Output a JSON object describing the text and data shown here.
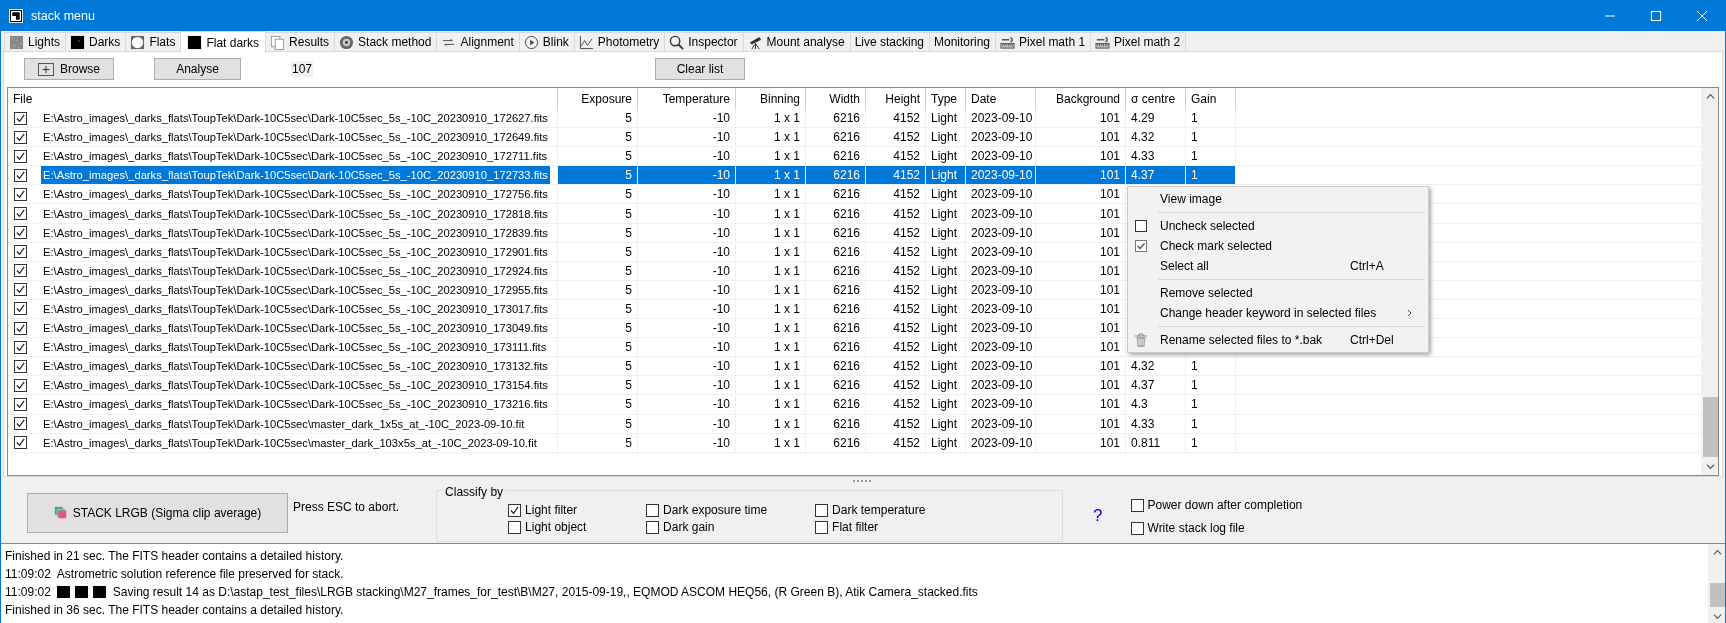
{
  "window": {
    "title": "stack menu"
  },
  "tabs": [
    {
      "label": "Lights",
      "selected": false
    },
    {
      "label": "Darks",
      "selected": false
    },
    {
      "label": "Flats",
      "selected": false
    },
    {
      "label": "Flat darks",
      "selected": true
    },
    {
      "label": "Results",
      "selected": false
    },
    {
      "label": "Stack method",
      "selected": false
    },
    {
      "label": "Alignment",
      "selected": false
    },
    {
      "label": "Blink",
      "selected": false
    },
    {
      "label": "Photometry",
      "selected": false
    },
    {
      "label": "Inspector",
      "selected": false
    },
    {
      "label": "Mount analyse",
      "selected": false
    },
    {
      "label": "Live stacking",
      "selected": false
    },
    {
      "label": "Monitoring",
      "selected": false
    },
    {
      "label": "Pixel math 1",
      "selected": false
    },
    {
      "label": "Pixel math 2",
      "selected": false
    }
  ],
  "toolbar": {
    "browse": "Browse",
    "analyse": "Analyse",
    "count": "107",
    "clear": "Clear list"
  },
  "table": {
    "columns": [
      {
        "label": "File"
      },
      {
        "label": "Exposure"
      },
      {
        "label": "Temperature"
      },
      {
        "label": "Binning"
      },
      {
        "label": "Width"
      },
      {
        "label": "Height"
      },
      {
        "label": "Type"
      },
      {
        "label": "Date"
      },
      {
        "label": "Background"
      },
      {
        "label": "σ centre"
      },
      {
        "label": "Gain"
      }
    ],
    "rows": [
      {
        "checked": true,
        "selected": false,
        "cells": [
          "E:\\Astro_images\\_darks_flats\\ToupTek\\Dark-10C5sec\\Dark-10C5sec_5s_-10C_20230910_172627.fits",
          "5",
          "-10",
          "1 x 1",
          "6216",
          "4152",
          "Light",
          "2023-09-10",
          "101",
          "4.29",
          "1"
        ]
      },
      {
        "checked": true,
        "selected": false,
        "cells": [
          "E:\\Astro_images\\_darks_flats\\ToupTek\\Dark-10C5sec\\Dark-10C5sec_5s_-10C_20230910_172649.fits",
          "5",
          "-10",
          "1 x 1",
          "6216",
          "4152",
          "Light",
          "2023-09-10",
          "101",
          "4.32",
          "1"
        ]
      },
      {
        "checked": true,
        "selected": false,
        "cells": [
          "E:\\Astro_images\\_darks_flats\\ToupTek\\Dark-10C5sec\\Dark-10C5sec_5s_-10C_20230910_172711.fits",
          "5",
          "-10",
          "1 x 1",
          "6216",
          "4152",
          "Light",
          "2023-09-10",
          "101",
          "4.33",
          "1"
        ]
      },
      {
        "checked": true,
        "selected": true,
        "cells": [
          "E:\\Astro_images\\_darks_flats\\ToupTek\\Dark-10C5sec\\Dark-10C5sec_5s_-10C_20230910_172733.fits",
          "5",
          "-10",
          "1 x 1",
          "6216",
          "4152",
          "Light",
          "2023-09-10",
          "101",
          "4.37",
          "1"
        ]
      },
      {
        "checked": true,
        "selected": false,
        "cells": [
          "E:\\Astro_images\\_darks_flats\\ToupTek\\Dark-10C5sec\\Dark-10C5sec_5s_-10C_20230910_172756.fits",
          "5",
          "-10",
          "1 x 1",
          "6216",
          "4152",
          "Light",
          "2023-09-10",
          "101"
        ]
      },
      {
        "checked": true,
        "selected": false,
        "cells": [
          "E:\\Astro_images\\_darks_flats\\ToupTek\\Dark-10C5sec\\Dark-10C5sec_5s_-10C_20230910_172818.fits",
          "5",
          "-10",
          "1 x 1",
          "6216",
          "4152",
          "Light",
          "2023-09-10",
          "101"
        ]
      },
      {
        "checked": true,
        "selected": false,
        "cells": [
          "E:\\Astro_images\\_darks_flats\\ToupTek\\Dark-10C5sec\\Dark-10C5sec_5s_-10C_20230910_172839.fits",
          "5",
          "-10",
          "1 x 1",
          "6216",
          "4152",
          "Light",
          "2023-09-10",
          "101"
        ]
      },
      {
        "checked": true,
        "selected": false,
        "cells": [
          "E:\\Astro_images\\_darks_flats\\ToupTek\\Dark-10C5sec\\Dark-10C5sec_5s_-10C_20230910_172901.fits",
          "5",
          "-10",
          "1 x 1",
          "6216",
          "4152",
          "Light",
          "2023-09-10",
          "101"
        ]
      },
      {
        "checked": true,
        "selected": false,
        "cells": [
          "E:\\Astro_images\\_darks_flats\\ToupTek\\Dark-10C5sec\\Dark-10C5sec_5s_-10C_20230910_172924.fits",
          "5",
          "-10",
          "1 x 1",
          "6216",
          "4152",
          "Light",
          "2023-09-10",
          "101"
        ]
      },
      {
        "checked": true,
        "selected": false,
        "cells": [
          "E:\\Astro_images\\_darks_flats\\ToupTek\\Dark-10C5sec\\Dark-10C5sec_5s_-10C_20230910_172955.fits",
          "5",
          "-10",
          "1 x 1",
          "6216",
          "4152",
          "Light",
          "2023-09-10",
          "101"
        ]
      },
      {
        "checked": true,
        "selected": false,
        "cells": [
          "E:\\Astro_images\\_darks_flats\\ToupTek\\Dark-10C5sec\\Dark-10C5sec_5s_-10C_20230910_173017.fits",
          "5",
          "-10",
          "1 x 1",
          "6216",
          "4152",
          "Light",
          "2023-09-10",
          "101"
        ]
      },
      {
        "checked": true,
        "selected": false,
        "cells": [
          "E:\\Astro_images\\_darks_flats\\ToupTek\\Dark-10C5sec\\Dark-10C5sec_5s_-10C_20230910_173049.fits",
          "5",
          "-10",
          "1 x 1",
          "6216",
          "4152",
          "Light",
          "2023-09-10",
          "101"
        ]
      },
      {
        "checked": true,
        "selected": false,
        "cells": [
          "E:\\Astro_images\\_darks_flats\\ToupTek\\Dark-10C5sec\\Dark-10C5sec_5s_-10C_20230910_173111.fits",
          "5",
          "-10",
          "1 x 1",
          "6216",
          "4152",
          "Light",
          "2023-09-10",
          "101"
        ]
      },
      {
        "checked": true,
        "selected": false,
        "cells": [
          "E:\\Astro_images\\_darks_flats\\ToupTek\\Dark-10C5sec\\Dark-10C5sec_5s_-10C_20230910_173132.fits",
          "5",
          "-10",
          "1 x 1",
          "6216",
          "4152",
          "Light",
          "2023-09-10",
          "101",
          "4.32",
          "1"
        ]
      },
      {
        "checked": true,
        "selected": false,
        "cells": [
          "E:\\Astro_images\\_darks_flats\\ToupTek\\Dark-10C5sec\\Dark-10C5sec_5s_-10C_20230910_173154.fits",
          "5",
          "-10",
          "1 x 1",
          "6216",
          "4152",
          "Light",
          "2023-09-10",
          "101",
          "4.37",
          "1"
        ]
      },
      {
        "checked": true,
        "selected": false,
        "cells": [
          "E:\\Astro_images\\_darks_flats\\ToupTek\\Dark-10C5sec\\Dark-10C5sec_5s_-10C_20230910_173216.fits",
          "5",
          "-10",
          "1 x 1",
          "6216",
          "4152",
          "Light",
          "2023-09-10",
          "101",
          "4.3",
          "1"
        ]
      },
      {
        "checked": true,
        "selected": false,
        "cells": [
          "E:\\Astro_images\\_darks_flats\\ToupTek\\Dark-10C5sec\\master_dark_1x5s_at_-10C_2023-09-10.fit",
          "5",
          "-10",
          "1 x 1",
          "6216",
          "4152",
          "Light",
          "2023-09-10",
          "101",
          "4.33",
          "1"
        ]
      },
      {
        "checked": true,
        "selected": false,
        "cells": [
          "E:\\Astro_images\\_darks_flats\\ToupTek\\Dark-10C5sec\\master_dark_103x5s_at_-10C_2023-09-10.fit",
          "5",
          "-10",
          "1 x 1",
          "6216",
          "4152",
          "Light",
          "2023-09-10",
          "101",
          "0.811",
          "1"
        ]
      }
    ]
  },
  "context_menu": {
    "items": [
      {
        "kind": "item",
        "label": "View image"
      },
      {
        "kind": "separator"
      },
      {
        "kind": "item",
        "label": "Uncheck selected"
      },
      {
        "kind": "item",
        "label": "Check mark selected"
      },
      {
        "kind": "item",
        "label": "Select all",
        "shortcut": "Ctrl+A"
      },
      {
        "kind": "separator"
      },
      {
        "kind": "item",
        "label": "Remove selected"
      },
      {
        "kind": "item",
        "label": "Change header keyword in selected files",
        "submenu": true
      },
      {
        "kind": "separator"
      },
      {
        "kind": "item",
        "label": "Rename selected files to *.bak",
        "shortcut": "Ctrl+Del"
      }
    ]
  },
  "stack_button": "STACK LRGB (Sigma clip average)",
  "abort_hint": "Press ESC to abort.",
  "classify": {
    "title": "Classify by",
    "options": [
      {
        "label": "Light filter",
        "checked": true
      },
      {
        "label": "Dark exposure time",
        "checked": false
      },
      {
        "label": "Dark temperature",
        "checked": false
      },
      {
        "label": "Light object",
        "checked": false
      },
      {
        "label": "Dark gain",
        "checked": false
      },
      {
        "label": "Flat filter",
        "checked": false
      }
    ]
  },
  "help": "?",
  "options": [
    {
      "label": "Power down after completion",
      "checked": false
    },
    {
      "label": "Write stack log file",
      "checked": false
    }
  ],
  "log": {
    "lines": [
      {
        "kind": "plain",
        "text": "Finished in 21 sec. The FITS header contains a detailed history."
      },
      {
        "kind": "timed",
        "time": "11:09:02",
        "text": "Astrometric solution reference file preserved for stack."
      },
      {
        "kind": "saved",
        "time": "11:09:02",
        "text": "Saving result 14 as D:\\astap_test_files\\LRGB stacking\\M27_frames_for_test\\B\\M27, 2015-09-19,, EQMOD ASCOM HEQ56, (R Green B), Atik Camera_stacked.fits"
      },
      {
        "kind": "plain",
        "text": "Finished in 36 sec. The FITS header contains a detailed history."
      }
    ]
  }
}
